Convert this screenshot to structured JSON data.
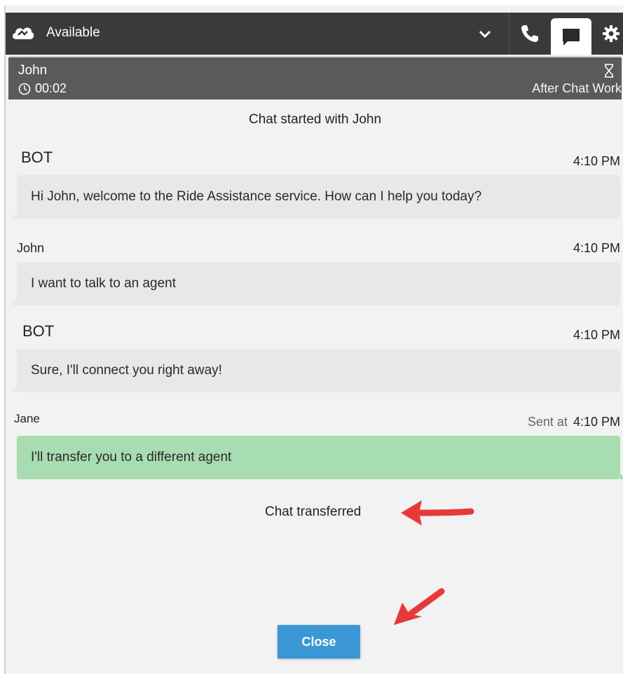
{
  "topbar": {
    "status": "Available",
    "icons": {
      "logo": "cloud-logo-icon",
      "dropdown": "chevron-down-icon",
      "phone": "phone-icon",
      "chat": "chat-icon",
      "settings": "gear-icon"
    }
  },
  "contact": {
    "name": "John",
    "timer": "00:02",
    "state": "After Chat Work"
  },
  "chat": {
    "started_prefix": "Chat started with",
    "started_name": "John",
    "messages": [
      {
        "sender": "BOT",
        "time": "4:10 PM",
        "text": "Hi John, welcome to the Ride Assistance service. How can I help you today?"
      },
      {
        "sender": "John",
        "time": "4:10 PM",
        "text": "I want to talk to an agent"
      },
      {
        "sender": "BOT",
        "time": "4:10 PM",
        "text": "Sure, I'll connect you right away!"
      },
      {
        "sender": "Jane",
        "sent_prefix": "Sent at",
        "time": "4:10 PM",
        "text": "I'll transfer you to a different agent"
      }
    ],
    "event": "Chat transferred"
  },
  "actions": {
    "close_label": "Close"
  },
  "colors": {
    "topbar_bg": "#3a3a3a",
    "contact_header_bg": "#5a5a5a",
    "incoming_bubble": "#e8e8e8",
    "agent_bubble": "#a8dcb1",
    "close_button": "#3b97d6",
    "annotation_arrow": "#e8393a"
  }
}
